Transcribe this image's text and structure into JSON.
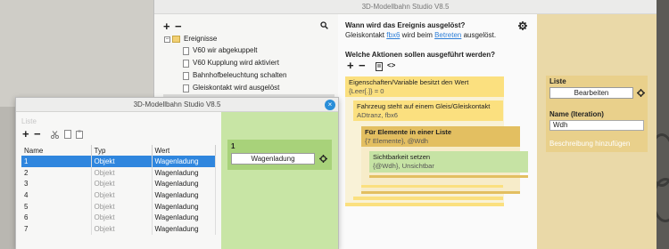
{
  "main_window": {
    "title": "3D-Modellbahn Studio V8.5",
    "tree": {
      "root": "Ereignisse",
      "items": [
        "V60 wir abgekuppelt",
        "V60 Kupplung wird aktiviert",
        "Bahnhofbeleuchtung schalten",
        "Gleiskontakt wird ausgelöst"
      ]
    },
    "event": {
      "question_when": "Wann wird das Ereignis ausgelöst?",
      "trigger_prefix": "Gleiskontakt",
      "trigger_object": "fbx6",
      "trigger_middle": "wird beim",
      "trigger_action": "Betreten",
      "trigger_suffix": "ausgelöst.",
      "question_actions": "Welche Aktionen sollen ausgeführt werden?",
      "blocks": [
        {
          "title": "Eigenschaften/Variable besitzt den Wert",
          "sub": "{Leer[.]} = 0"
        },
        {
          "title": "Fahrzeug steht auf einem Gleis/Gleiskontakt",
          "sub": "ADtranz, fbx6"
        },
        {
          "title": "Für Elemente in einer Liste",
          "sub": "{7 Elemente}, @Wdh"
        },
        {
          "title": "Sichtbarkeit setzen",
          "sub": "{@Wdh}, Unsichtbar"
        }
      ]
    },
    "side": {
      "list_label": "Liste",
      "edit_button": "Bearbeiten",
      "name_label": "Name (Iteration)",
      "name_value": "Wdh",
      "desc_placeholder": "Beschreibung hinzufügen"
    }
  },
  "popup": {
    "title": "3D-Modellbahn Studio V8.5",
    "close_label": "×",
    "list_placeholder": "Liste",
    "columns": [
      "Name",
      "Typ",
      "Wert"
    ],
    "rows": [
      {
        "name": "1",
        "typ": "Objekt",
        "wert": "Wagenladung"
      },
      {
        "name": "2",
        "typ": "Objekt",
        "wert": "Wagenladung"
      },
      {
        "name": "3",
        "typ": "Objekt",
        "wert": "Wagenladung"
      },
      {
        "name": "4",
        "typ": "Objekt",
        "wert": "Wagenladung"
      },
      {
        "name": "5",
        "typ": "Objekt",
        "wert": "Wagenladung"
      },
      {
        "name": "6",
        "typ": "Objekt",
        "wert": "Wagenladung"
      },
      {
        "name": "7",
        "typ": "Objekt",
        "wert": "Wagenladung"
      }
    ],
    "selected_row": 0,
    "item": {
      "index": "1",
      "value": "Wagenladung"
    }
  },
  "colors": {
    "accent": "#2f86de",
    "condition_block": "#fbe07f",
    "loop_block": "#e3bf61",
    "action_block": "#c6e3a4",
    "side_panel": "#ead9a8",
    "popup_panel": "#c8e5a5"
  },
  "icons": {
    "add": "plus-icon",
    "remove": "minus-icon",
    "search": "search-icon",
    "settings": "gear-icon",
    "copy": "copy-icon",
    "code": "code-icon",
    "cut": "scissors-icon",
    "paste": "paste-icon",
    "close": "close-icon"
  }
}
